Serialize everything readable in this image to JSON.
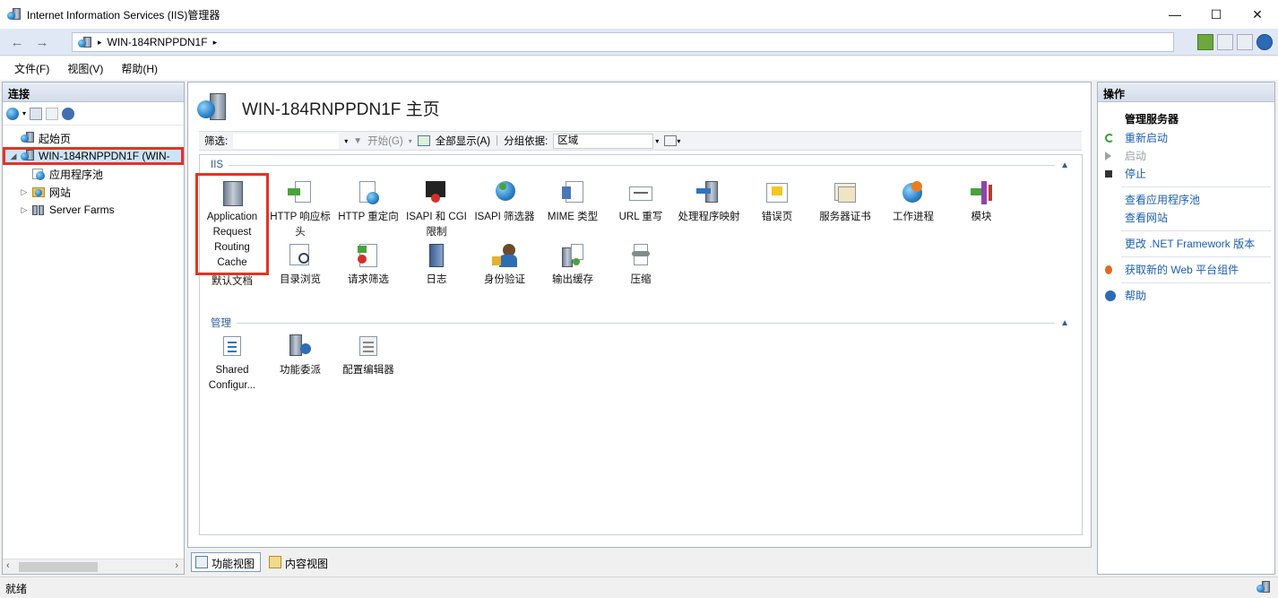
{
  "window": {
    "title": "Internet Information Services (IIS)管理器",
    "controls": [
      "—",
      "☐",
      "✕"
    ]
  },
  "address": {
    "back": "←",
    "forward": "→",
    "crumb_sep": "▸",
    "path": "WIN-184RNPPDN1F",
    "after_sep": "▸"
  },
  "menu": [
    "文件(F)",
    "视图(V)",
    "帮助(H)"
  ],
  "connections": {
    "title": "连接",
    "tree": [
      {
        "label": "起始页",
        "level": 1,
        "expander": ""
      },
      {
        "label": "WIN-184RNPPDN1F (WIN-",
        "level": 0,
        "expander": "◢",
        "selected": true
      },
      {
        "label": "应用程序池",
        "level": 2,
        "expander": ""
      },
      {
        "label": "网站",
        "level": 1,
        "expander": "▷"
      },
      {
        "label": "Server Farms",
        "level": 1,
        "expander": "▷"
      }
    ]
  },
  "center": {
    "title": "WIN-184RNPPDN1F 主页",
    "filter_label": "筛选:",
    "start_label": "开始(G)",
    "show_all_label": "全部显示(A)",
    "group_by_label": "分组依据:",
    "group_by_value": "区域",
    "groups": [
      {
        "name": "IIS",
        "collapse": "▲",
        "features": [
          "Application Request Routing Cache",
          "HTTP 响应标头",
          "HTTP 重定向",
          "ISAPI 和 CGI 限制",
          "ISAPI 筛选器",
          "MIME 类型",
          "URL 重写",
          "处理程序映射",
          "错误页",
          "服务器证书",
          "工作进程",
          "模块",
          "默认文档",
          "目录浏览",
          "请求筛选",
          "日志",
          "身份验证",
          "输出缓存",
          "压缩"
        ]
      },
      {
        "name": "管理",
        "collapse": "▲",
        "features": [
          "Shared Configur...",
          "功能委派",
          "配置编辑器"
        ]
      }
    ],
    "view_tabs": [
      "功能视图",
      "内容视图"
    ]
  },
  "actions": {
    "title": "操作",
    "section": "管理服务器",
    "items": [
      {
        "label": "重新启动",
        "enabled": true,
        "icon": "restart-icon"
      },
      {
        "label": "启动",
        "enabled": false,
        "icon": "start-icon"
      },
      {
        "label": "停止",
        "enabled": true,
        "icon": "stop-icon"
      },
      {
        "label": "查看应用程序池",
        "enabled": true
      },
      {
        "label": "查看网站",
        "enabled": true
      },
      {
        "label": "更改 .NET Framework 版本",
        "enabled": true
      },
      {
        "label": "获取新的 Web 平台组件",
        "enabled": true,
        "icon": "web-platform-icon"
      },
      {
        "label": "帮助",
        "enabled": true,
        "icon": "help-icon"
      }
    ]
  },
  "status": {
    "text": "就绪"
  }
}
